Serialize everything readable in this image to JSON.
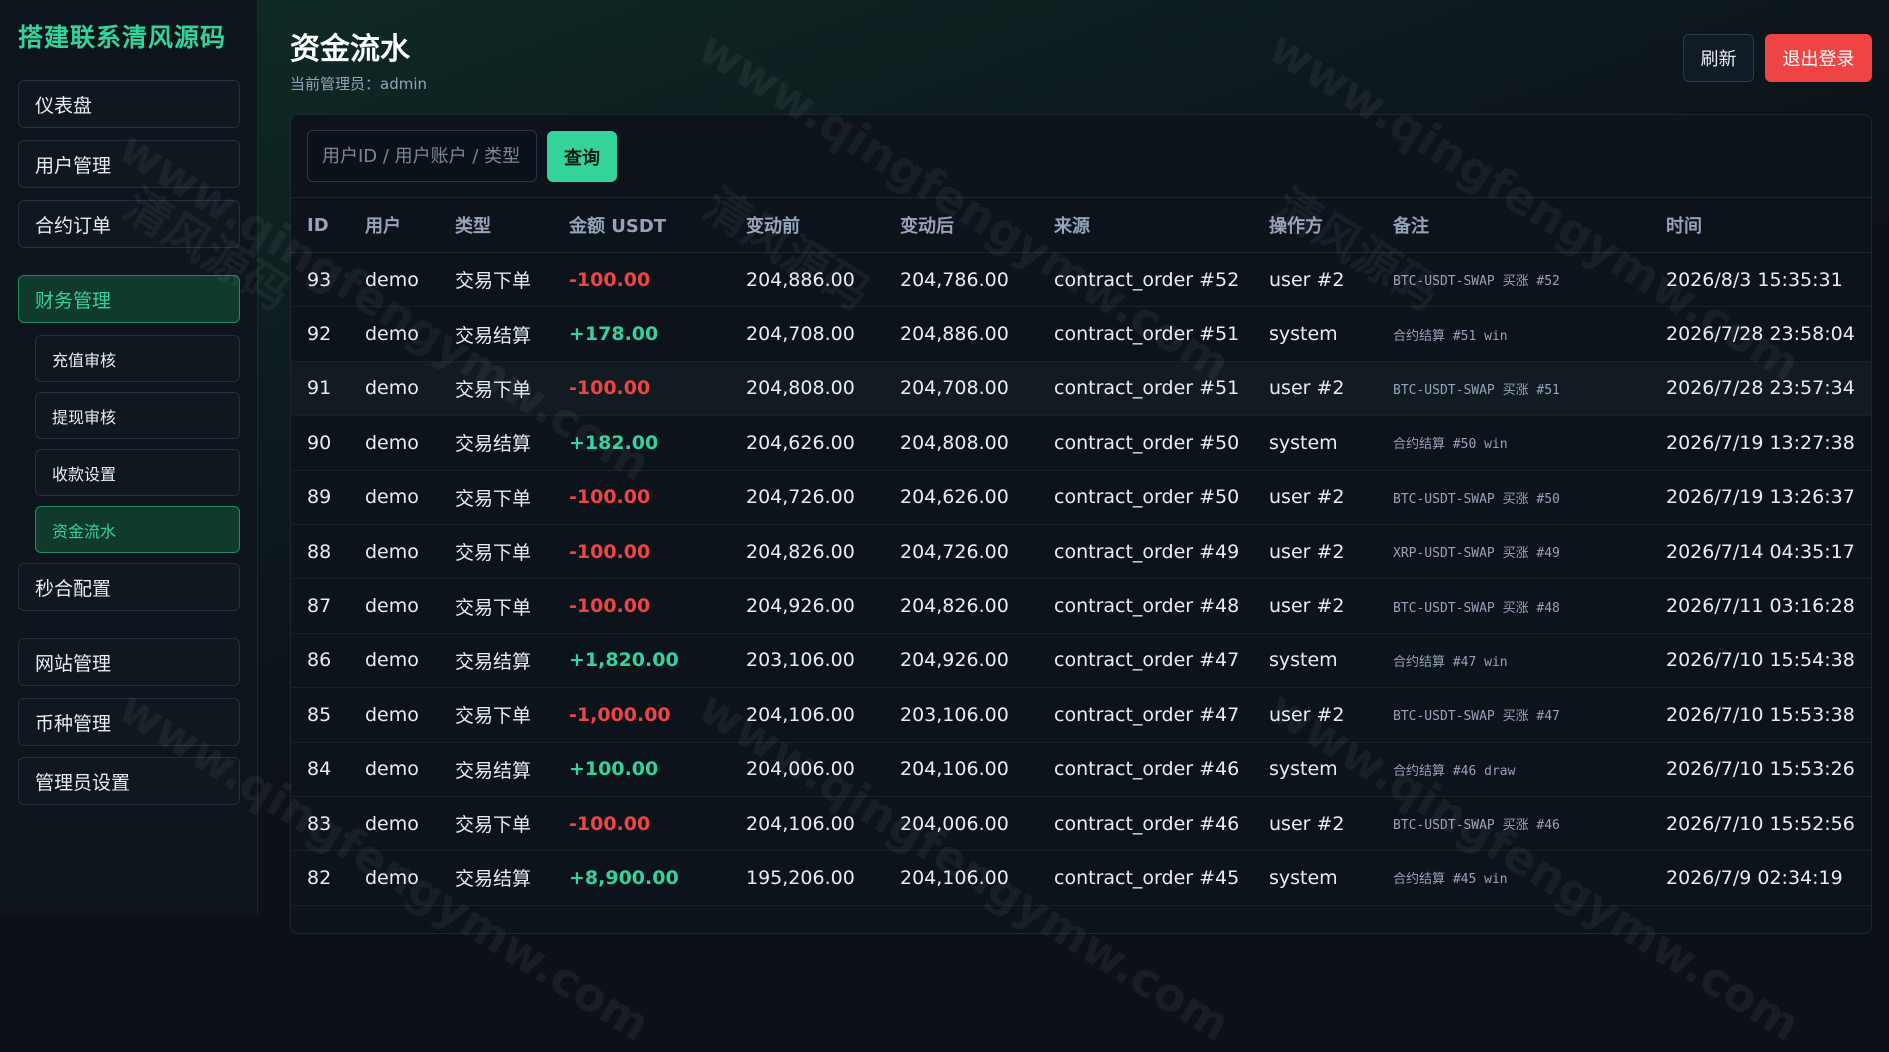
{
  "brand": "搭建联系清风源码",
  "sidebar": {
    "items": [
      {
        "label": "仪表盘"
      },
      {
        "label": "用户管理"
      },
      {
        "label": "合约订单"
      },
      {
        "label": "财务管理"
      },
      {
        "label": "秒合配置"
      },
      {
        "label": "网站管理"
      },
      {
        "label": "币种管理"
      },
      {
        "label": "管理员设置"
      }
    ],
    "sub_items": [
      {
        "label": "充值审核"
      },
      {
        "label": "提现审核"
      },
      {
        "label": "收款设置"
      },
      {
        "label": "资金流水"
      }
    ]
  },
  "header": {
    "title": "资金流水",
    "subtitle": "当前管理员：admin",
    "refresh_label": "刷新",
    "logout_label": "退出登录"
  },
  "search": {
    "placeholder": "用户ID / 用户账户 / 类型",
    "query_label": "查询"
  },
  "table": {
    "columns": [
      "ID",
      "用户",
      "类型",
      "金额 USDT",
      "变动前",
      "变动后",
      "来源",
      "操作方",
      "备注",
      "时间"
    ],
    "rows": [
      {
        "id": "93",
        "user": "demo",
        "type": "交易下单",
        "amount": "-100.00",
        "sign": "neg",
        "before": "204,886.00",
        "after": "204,786.00",
        "source": "contract_order #52",
        "operator": "user #2",
        "note": "BTC-USDT-SWAP 买涨 #52",
        "time": "2026/8/3 15:35:31"
      },
      {
        "id": "92",
        "user": "demo",
        "type": "交易结算",
        "amount": "+178.00",
        "sign": "pos",
        "before": "204,708.00",
        "after": "204,886.00",
        "source": "contract_order #51",
        "operator": "system",
        "note": "合约结算 #51 win",
        "time": "2026/7/28 23:58:04"
      },
      {
        "id": "91",
        "user": "demo",
        "type": "交易下单",
        "amount": "-100.00",
        "sign": "neg",
        "before": "204,808.00",
        "after": "204,708.00",
        "source": "contract_order #51",
        "operator": "user #2",
        "note": "BTC-USDT-SWAP 买涨 #51",
        "time": "2026/7/28 23:57:34"
      },
      {
        "id": "90",
        "user": "demo",
        "type": "交易结算",
        "amount": "+182.00",
        "sign": "pos",
        "before": "204,626.00",
        "after": "204,808.00",
        "source": "contract_order #50",
        "operator": "system",
        "note": "合约结算 #50 win",
        "time": "2026/7/19 13:27:38"
      },
      {
        "id": "89",
        "user": "demo",
        "type": "交易下单",
        "amount": "-100.00",
        "sign": "neg",
        "before": "204,726.00",
        "after": "204,626.00",
        "source": "contract_order #50",
        "operator": "user #2",
        "note": "BTC-USDT-SWAP 买涨 #50",
        "time": "2026/7/19 13:26:37"
      },
      {
        "id": "88",
        "user": "demo",
        "type": "交易下单",
        "amount": "-100.00",
        "sign": "neg",
        "before": "204,826.00",
        "after": "204,726.00",
        "source": "contract_order #49",
        "operator": "user #2",
        "note": "XRP-USDT-SWAP 买涨 #49",
        "time": "2026/7/14 04:35:17"
      },
      {
        "id": "87",
        "user": "demo",
        "type": "交易下单",
        "amount": "-100.00",
        "sign": "neg",
        "before": "204,926.00",
        "after": "204,826.00",
        "source": "contract_order #48",
        "operator": "user #2",
        "note": "BTC-USDT-SWAP 买涨 #48",
        "time": "2026/7/11 03:16:28"
      },
      {
        "id": "86",
        "user": "demo",
        "type": "交易结算",
        "amount": "+1,820.00",
        "sign": "pos",
        "before": "203,106.00",
        "after": "204,926.00",
        "source": "contract_order #47",
        "operator": "system",
        "note": "合约结算 #47 win",
        "time": "2026/7/10 15:54:38"
      },
      {
        "id": "85",
        "user": "demo",
        "type": "交易下单",
        "amount": "-1,000.00",
        "sign": "neg",
        "before": "204,106.00",
        "after": "203,106.00",
        "source": "contract_order #47",
        "operator": "user #2",
        "note": "BTC-USDT-SWAP 买涨 #47",
        "time": "2026/7/10 15:53:38"
      },
      {
        "id": "84",
        "user": "demo",
        "type": "交易结算",
        "amount": "+100.00",
        "sign": "pos",
        "before": "204,006.00",
        "after": "204,106.00",
        "source": "contract_order #46",
        "operator": "system",
        "note": "合约结算 #46 draw",
        "time": "2026/7/10 15:53:26"
      },
      {
        "id": "83",
        "user": "demo",
        "type": "交易下单",
        "amount": "-100.00",
        "sign": "neg",
        "before": "204,106.00",
        "after": "204,006.00",
        "source": "contract_order #46",
        "operator": "user #2",
        "note": "BTC-USDT-SWAP 买涨 #46",
        "time": "2026/7/10 15:52:56"
      },
      {
        "id": "82",
        "user": "demo",
        "type": "交易结算",
        "amount": "+8,900.00",
        "sign": "pos",
        "before": "195,206.00",
        "after": "204,106.00",
        "source": "contract_order #45",
        "operator": "system",
        "note": "合约结算 #45 win",
        "time": "2026/7/9 02:34:19"
      }
    ]
  },
  "watermark": [
    "www.qingfengymw.com",
    "清风源码"
  ],
  "colors": {
    "accent": "#34d399",
    "danger": "#ef4444",
    "background": "#0c1118"
  }
}
